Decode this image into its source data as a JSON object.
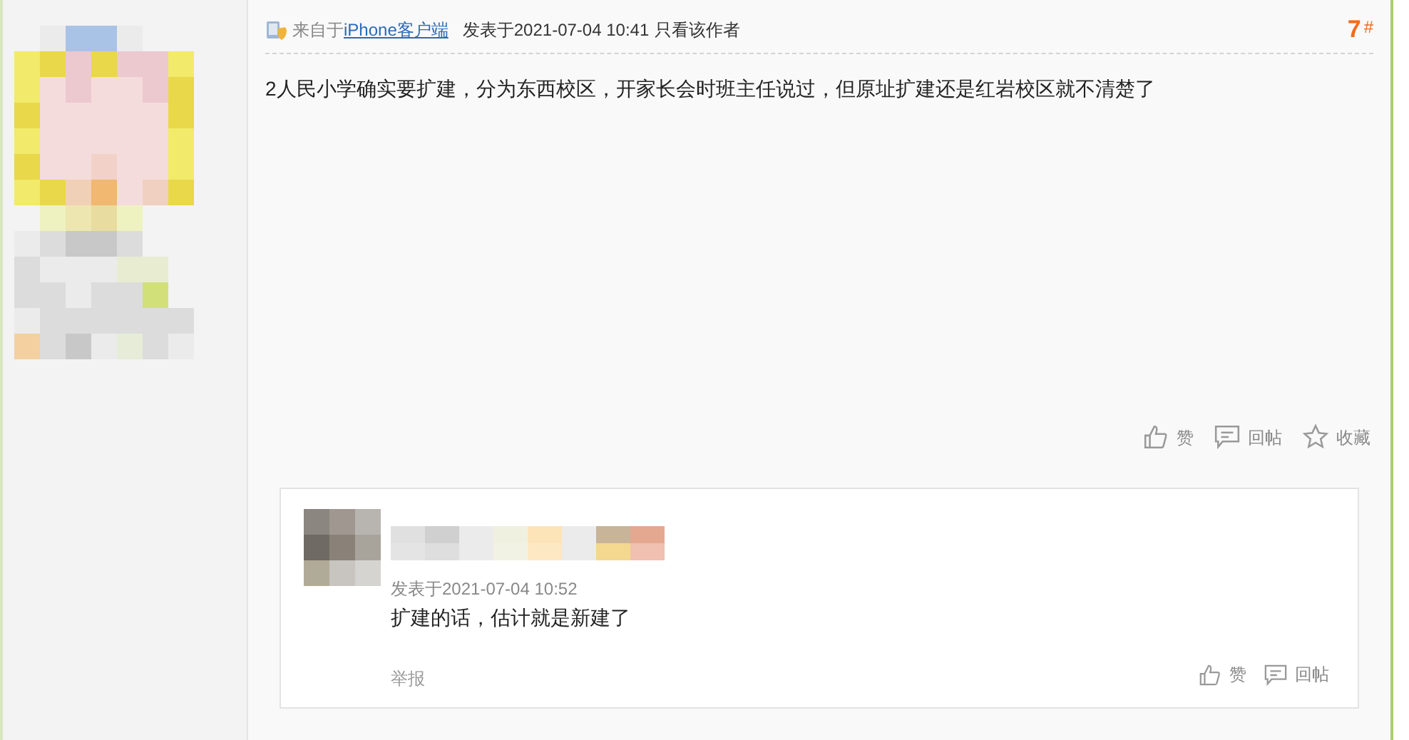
{
  "post": {
    "source_prefix": "来自于",
    "source_link": "iPhone客户端",
    "posted": "发表于2021-07-04 10:41",
    "only_author": "只看该作者",
    "floor": "7",
    "floor_mark": "#",
    "body": "2人民小学确实要扩建，分为东西校区，开家长会时班主任说过，但原址扩建还是红岩校区就不清楚了",
    "actions": [
      {
        "kind": "like",
        "label": "赞"
      },
      {
        "kind": "reply",
        "label": "回帖"
      },
      {
        "kind": "favorite",
        "label": "收藏"
      }
    ]
  },
  "comment": {
    "posted": "发表于2021-07-04 10:52",
    "body": "扩建的话，估计就是新建了",
    "report": "举报",
    "actions": [
      {
        "kind": "like",
        "label": "赞"
      },
      {
        "kind": "reply",
        "label": "回帖"
      }
    ]
  }
}
